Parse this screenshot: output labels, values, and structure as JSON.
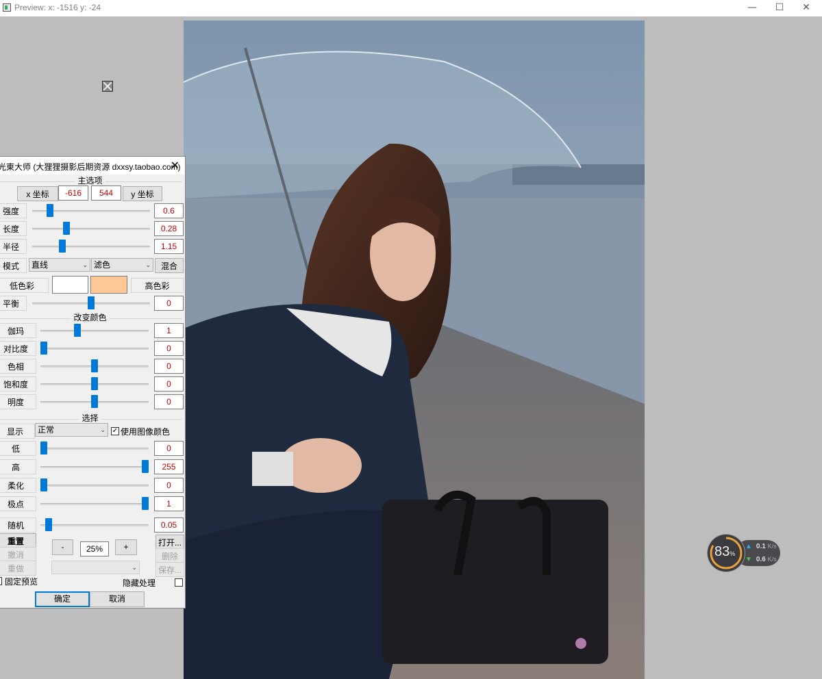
{
  "window": {
    "title": "Preview:  x: -1516 y: -24",
    "minimize": "—",
    "maximize": "☐",
    "close": "✕"
  },
  "net_widget": {
    "percent": "83",
    "percent_unit": "%",
    "up": "0.1",
    "up_unit": "K/s",
    "down": "0.6",
    "down_unit": "K/s"
  },
  "dialog": {
    "title": "光東大师 (大狸狸摄影后期资源 dxxsy.taobao.com)",
    "close": "✕",
    "main_section": "主选项",
    "x_label": "x 坐标",
    "x_value": "-616",
    "y_value": "544",
    "y_label": "y 坐标",
    "sliders_main": [
      {
        "label": "强度",
        "value": "0.6",
        "level": 0.13
      },
      {
        "label": "长度",
        "value": "0.28",
        "level": 0.28
      },
      {
        "label": "半径",
        "value": "1.15",
        "level": 0.24
      }
    ],
    "mode_label": "模式",
    "mode_style": "直线",
    "mode_blend": "滤色",
    "mix_button": "混合",
    "low_color_label": "低色彩",
    "high_color_label": "高色彩",
    "low_color": "#ffffff",
    "high_color": "#ffc896",
    "balance": {
      "label": "平衡",
      "value": "0",
      "level": 0.5
    },
    "color_section": "改变颜色",
    "sliders_color": [
      {
        "label": "伽玛",
        "value": "1",
        "level": 0.33
      },
      {
        "label": "对比度",
        "value": "0",
        "level": 0.0
      },
      {
        "label": "色相",
        "value": "0",
        "level": 0.5
      },
      {
        "label": "饱和度",
        "value": "0",
        "level": 0.5
      },
      {
        "label": "明度",
        "value": "0",
        "level": 0.5
      }
    ],
    "select_section": "选择",
    "display_label": "显示",
    "display_value": "正常",
    "use_image_color": "使用图像颜色",
    "sliders_select": [
      {
        "label": "低",
        "value": "0",
        "level": 0.0
      },
      {
        "label": "高",
        "value": "255",
        "level": 1.0
      },
      {
        "label": "柔化",
        "value": "0",
        "level": 0.0
      },
      {
        "label": "极点",
        "value": "1",
        "level": 1.0
      }
    ],
    "random": {
      "label": "随机",
      "value": "0.05",
      "level": 0.05
    },
    "reset": "重置",
    "undo": "撤消",
    "redo": "重做",
    "zoom_minus": "-",
    "zoom_value": "25%",
    "zoom_plus": "+",
    "open": "打开...",
    "delete": "删除",
    "save": "保存...",
    "fixed_preview": "固定预览",
    "hide_processing": "隐藏处理",
    "ok": "确定",
    "cancel": "取消"
  }
}
